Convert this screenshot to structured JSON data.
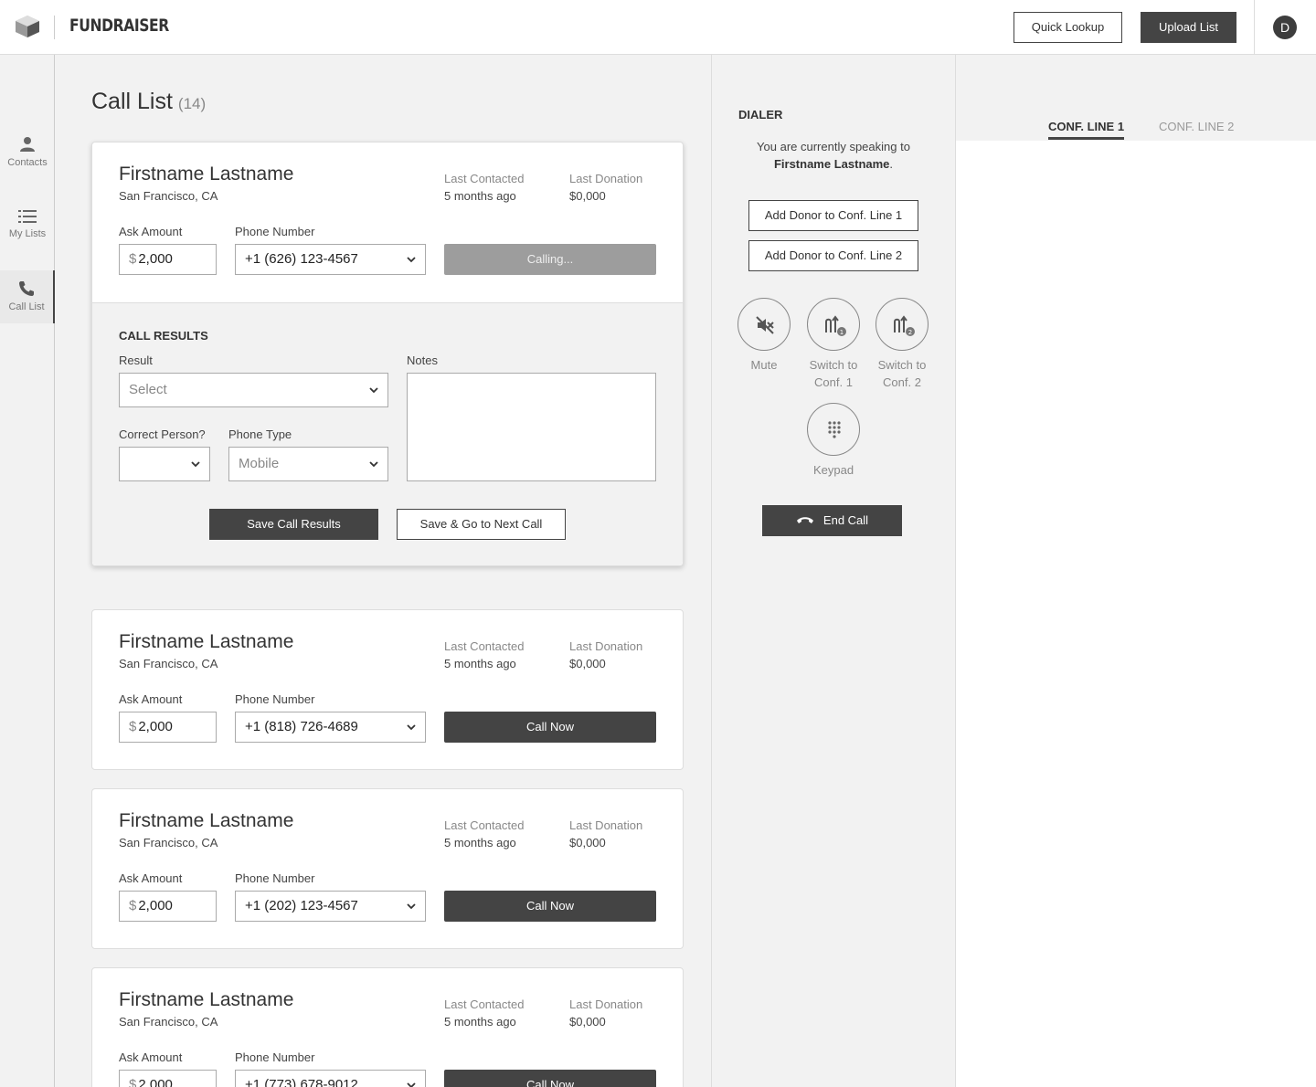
{
  "header": {
    "brand": "FUNDRAISER",
    "quick_lookup": "Quick Lookup",
    "upload_list": "Upload List",
    "avatar_initial": "D"
  },
  "sidebar": {
    "items": [
      {
        "label": "Contacts",
        "icon": "person-icon"
      },
      {
        "label": "My Lists",
        "icon": "list-icon"
      },
      {
        "label": "Call List",
        "icon": "phone-icon",
        "active": true
      }
    ]
  },
  "main": {
    "title": "Call List",
    "count": "(14)",
    "labels": {
      "last_contacted": "Last Contacted",
      "last_donation": "Last Donation",
      "ask_amount": "Ask Amount",
      "phone_number": "Phone Number",
      "currency": "$"
    },
    "contacts": [
      {
        "name": "Firstname Lastname",
        "location": "San Francisco, CA",
        "last_contacted": "5 months ago",
        "last_donation": "$0,000",
        "ask": "2,000",
        "phone": "+1 (626) 123-4567",
        "action": "Calling..."
      },
      {
        "name": "Firstname Lastname",
        "location": "San Francisco, CA",
        "last_contacted": "5 months ago",
        "last_donation": "$0,000",
        "ask": "2,000",
        "phone": "+1 (818) 726-4689",
        "action": "Call Now"
      },
      {
        "name": "Firstname Lastname",
        "location": "San Francisco, CA",
        "last_contacted": "5 months ago",
        "last_donation": "$0,000",
        "ask": "2,000",
        "phone": "+1 (202) 123-4567",
        "action": "Call Now"
      },
      {
        "name": "Firstname Lastname",
        "location": "San Francisco, CA",
        "last_contacted": "5 months ago",
        "last_donation": "$0,000",
        "ask": "2,000",
        "phone": "+1 (773) 678-9012",
        "action": "Call Now"
      }
    ],
    "call_results": {
      "title": "CALL RESULTS",
      "result_label": "Result",
      "result_placeholder": "Select",
      "notes_label": "Notes",
      "correct_person_label": "Correct Person?",
      "correct_person_value": "",
      "phone_type_label": "Phone Type",
      "phone_type_value": "Mobile",
      "save_label": "Save Call Results",
      "save_next_label": "Save & Go to Next Call"
    }
  },
  "dialer": {
    "title": "DIALER",
    "status_prefix": "You are currently speaking to",
    "status_name": "Firstname Lastname",
    "status_suffix": ".",
    "add_conf1": "Add Donor to Conf. Line 1",
    "add_conf2": "Add Donor to Conf. Line 2",
    "controls": {
      "mute": "Mute",
      "switch1_a": "Switch to",
      "switch1_b": "Conf. 1",
      "switch2_a": "Switch to",
      "switch2_b": "Conf. 2",
      "keypad": "Keypad"
    },
    "end_call": "End Call"
  },
  "conference": {
    "tabs": [
      "CONF. LINE 1",
      "CONF. LINE 2"
    ]
  }
}
